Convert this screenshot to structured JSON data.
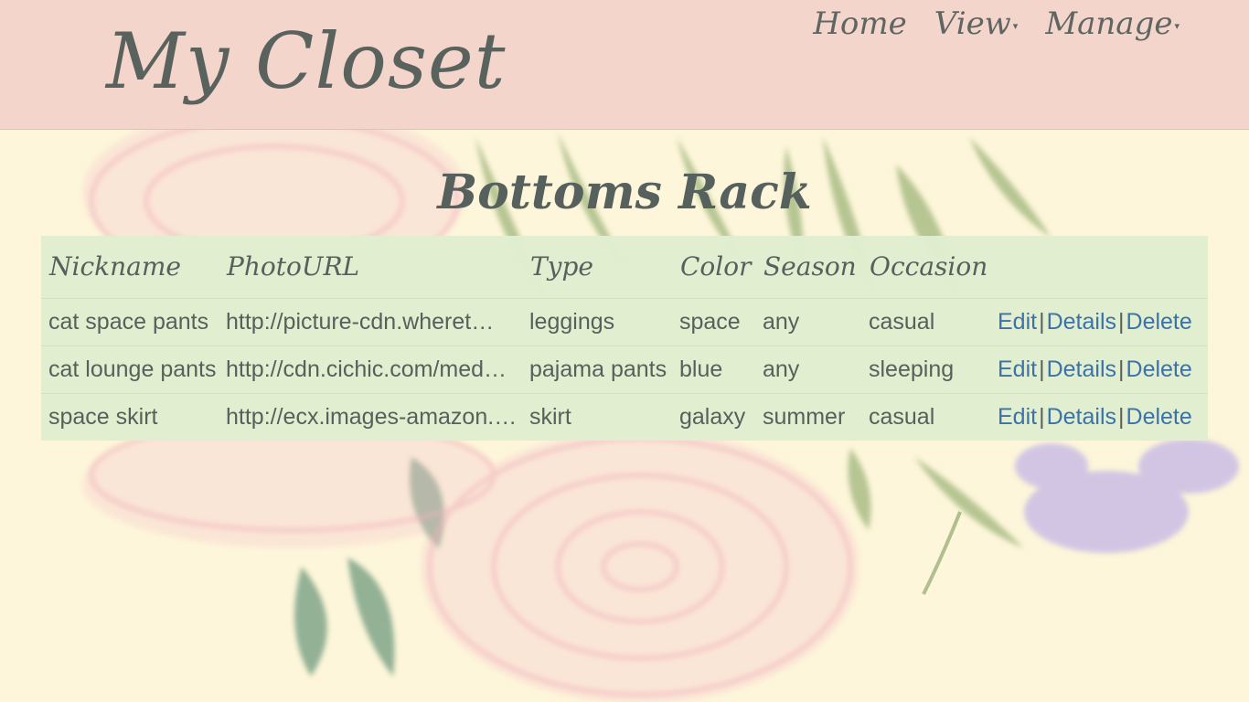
{
  "brand": "My Closet",
  "nav": {
    "home": "Home",
    "view": "View",
    "manage": "Manage"
  },
  "page_title": "Bottoms Rack",
  "table": {
    "headers": [
      "Nickname",
      "PhotoURL",
      "Type",
      "Color",
      "Season",
      "Occasion"
    ],
    "rows": [
      {
        "nickname": "cat space pants",
        "photo_url": "http://picture-cdn.wheret…",
        "type": "leggings",
        "color": "space",
        "season": "any",
        "occasion": "casual"
      },
      {
        "nickname": "cat lounge pants",
        "photo_url": "http://cdn.cichic.com/med…",
        "type": "pajama pants",
        "color": "blue",
        "season": "any",
        "occasion": "sleeping"
      },
      {
        "nickname": "space skirt",
        "photo_url": "http://ecx.images-amazon.…",
        "type": "skirt",
        "color": "galaxy",
        "season": "summer",
        "occasion": "casual"
      }
    ],
    "actions": {
      "edit": "Edit",
      "details": "Details",
      "delete": "Delete",
      "separator": "|"
    }
  },
  "colors": {
    "navbar_bg": "#f4d5cb",
    "page_bg": "#fdf6da",
    "table_bg": "#e0eecf",
    "link": "#3a72a9",
    "text": "#555d59"
  }
}
